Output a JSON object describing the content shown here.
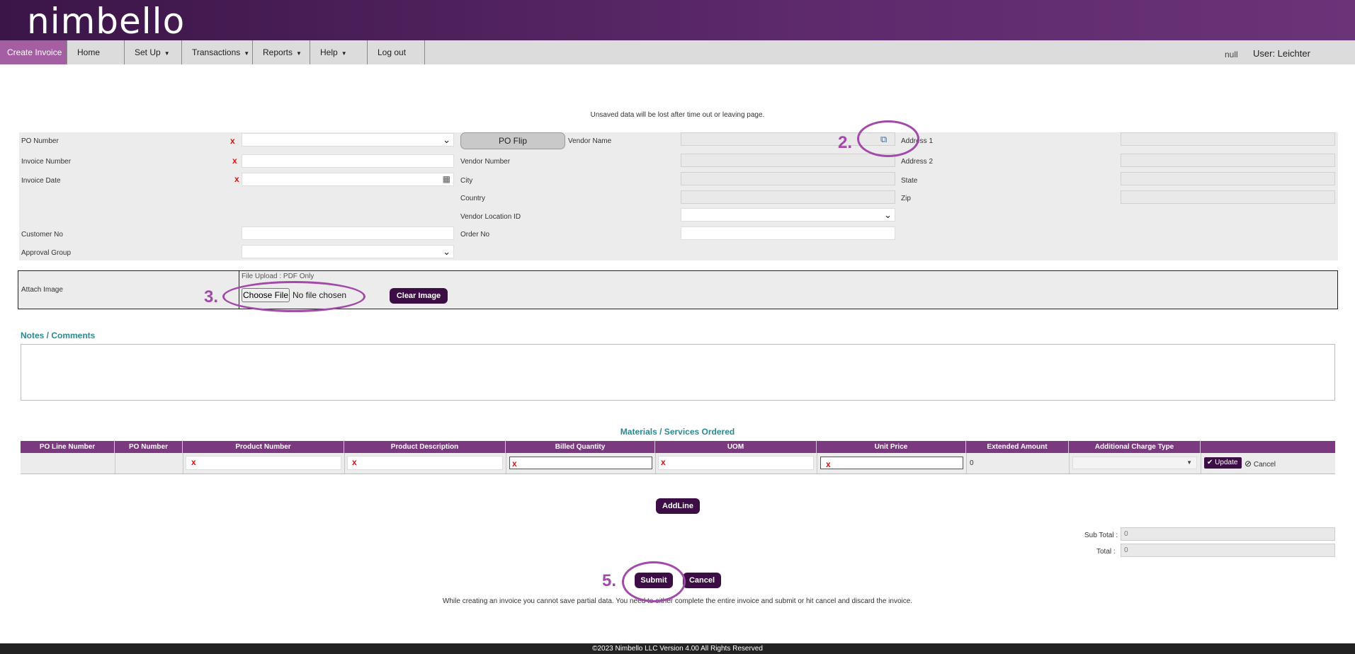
{
  "app": {
    "logo": "nimbello"
  },
  "nav": {
    "items": [
      {
        "label": "Create Invoice",
        "has_menu": false
      },
      {
        "label": "Home",
        "has_menu": false
      },
      {
        "label": "Set Up",
        "has_menu": true
      },
      {
        "label": "Transactions",
        "has_menu": true
      },
      {
        "label": "Reports",
        "has_menu": true
      },
      {
        "label": "Help",
        "has_menu": true
      },
      {
        "label": "Log out",
        "has_menu": false
      }
    ],
    "caret": "▼",
    "status": "null",
    "user": "User: Leichter"
  },
  "notice": "Unsaved data will be lost after time out or leaving page.",
  "form": {
    "required_mark": "x",
    "po_number_label": "PO Number",
    "invoice_number_label": "Invoice Number",
    "invoice_date_label": "Invoice Date",
    "customer_no_label": "Customer No",
    "approval_group_label": "Approval Group",
    "po_flip_label": "PO Flip",
    "vendor_name_label": "Vendor Name",
    "vendor_number_label": "Vendor Number",
    "city_label": "City",
    "country_label": "Country",
    "vendor_location_label": "Vendor Location ID",
    "order_no_label": "Order No",
    "address1_label": "Address 1",
    "address2_label": "Address 2",
    "state_label": "State",
    "zip_label": "Zip",
    "dropdown_arrow": "⌄",
    "calendar_icon": "▦",
    "external_link_icon": "⧉"
  },
  "attach": {
    "label": "Attach Image",
    "upload_hint": "File Upload : PDF Only",
    "choose_button": "Choose File",
    "no_file": "No file chosen",
    "clear_button": "Clear Image"
  },
  "notes": {
    "title": "Notes / Comments"
  },
  "materials": {
    "title": "Materials / Services Ordered",
    "columns": [
      "PO Line Number",
      "PO Number",
      "Product Number",
      "Product Description",
      "Billed Quantity",
      "UOM",
      "Unit Price",
      "Extended Amount",
      "Additional Charge Type",
      ""
    ],
    "row": {
      "extended_amount": "0"
    },
    "update_label": "Update",
    "cancel_label": "Cancel",
    "check_icon": "✔",
    "cancel_icon": "⊘",
    "select_arrow": "▼",
    "add_line": "AddLine"
  },
  "totals": {
    "subtotal_label": "Sub Total :",
    "subtotal_value": "0",
    "total_label": "Total :",
    "total_value": "0"
  },
  "actions": {
    "submit": "Submit",
    "cancel": "Cancel"
  },
  "bottom_note": "While creating an invoice you cannot save partial data. You need to either complete the entire invoice and submit or hit cancel and discard the invoice.",
  "footer": "©2023 Nimbello LLC Version 4.00 All Rights Reserved",
  "callouts": {
    "two": "2.",
    "three": "3.",
    "five": "5."
  },
  "colors": {
    "brand": "#4a1d58",
    "accent": "#a45fa3",
    "teal": "#2a8a90",
    "callout": "#a24aa9"
  }
}
